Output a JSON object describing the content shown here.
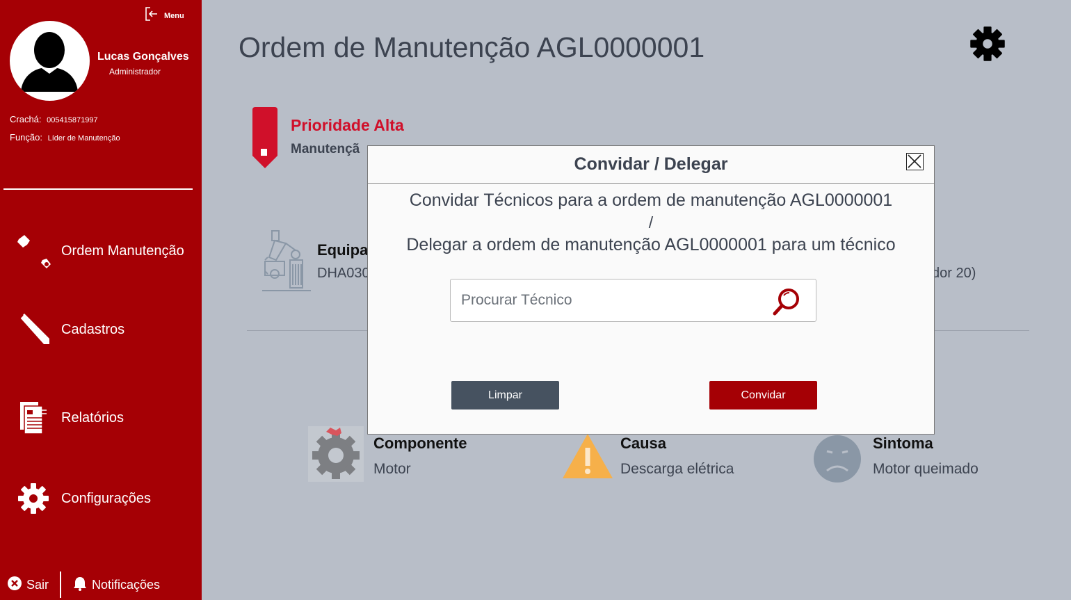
{
  "sidebar": {
    "menu_label": "Menu",
    "user_name": "Lucas Gonçalves",
    "user_role": "Administrador",
    "badge_label": "Crachá:",
    "badge_value": "005415871997",
    "function_label": "Função:",
    "function_value": "Líder de Manutenção",
    "nav": [
      {
        "label": "Ordem Manutenção",
        "icon": "wrench-icon"
      },
      {
        "label": "Cadastros",
        "icon": "pencil-icon"
      },
      {
        "label": "Relatórios",
        "icon": "report-icon"
      },
      {
        "label": "Configurações",
        "icon": "gear-icon"
      }
    ],
    "logout_label": "Sair",
    "notifications_label": "Notificações"
  },
  "main": {
    "title": "Ordem de Manutenção AGL0000001",
    "priority_title": "Prioridade Alta",
    "priority_sub": "Manutençã",
    "equipment_title": "Equipa",
    "equipment_code": "DHA030",
    "equipment_right": "dor 20)",
    "details": [
      {
        "title": "Componente",
        "value": "Motor",
        "icon": "component-gear-icon"
      },
      {
        "title": "Causa",
        "value": "Descarga elétrica",
        "icon": "warning-icon"
      },
      {
        "title": "Sintoma",
        "value": "Motor queimado",
        "icon": "sad-face-icon"
      }
    ]
  },
  "modal": {
    "title": "Convidar / Delegar",
    "line1": "Convidar Técnicos para a ordem de manutenção AGL0000001",
    "line2": "/",
    "line3": "Delegar a ordem de manutenção AGL0000001 para um técnico",
    "search_placeholder": "Procurar Técnico",
    "search_value": "",
    "clear_label": "Limpar",
    "invite_label": "Convidar"
  },
  "colors": {
    "sidebar": "#a50005",
    "background": "#b8bec8",
    "priority": "#d0102a",
    "button_dark": "#465260"
  }
}
